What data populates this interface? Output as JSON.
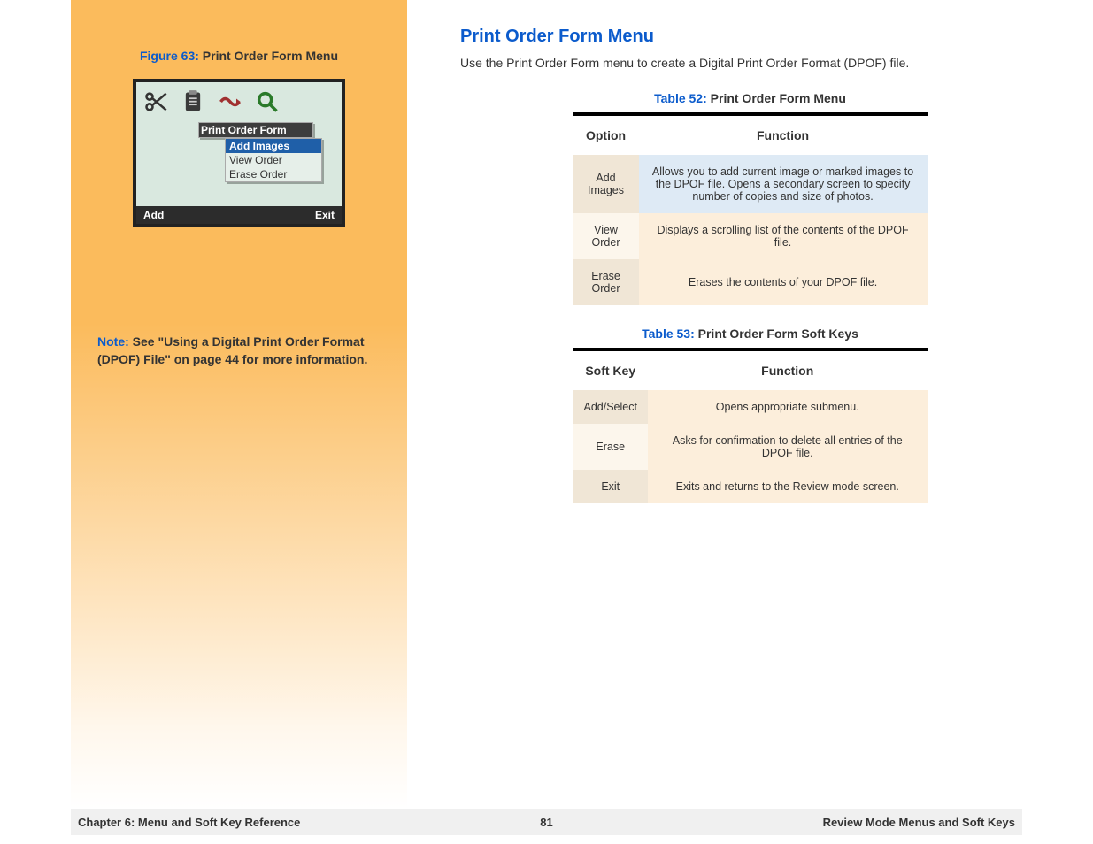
{
  "sidebar": {
    "figure_label": "Figure 63:",
    "figure_title": "Print Order Form Menu",
    "lcd": {
      "menu_title": "Print Order Form",
      "items": [
        "Add Images",
        "View Order",
        "Erase Order"
      ],
      "soft_left": "Add",
      "soft_right": "Exit"
    },
    "note_label": "Note:",
    "note_text_1": "See \"Using a Digital Print Order Format (DPOF) File\" on page 44 for more information."
  },
  "main": {
    "heading": "Print Order Form Menu",
    "intro": "Use the Print Order Form menu to create a Digital Print Order Format (DPOF) file.",
    "table52": {
      "label": "Table 52:",
      "title": "Print Order Form Menu",
      "headers": [
        "Option",
        "Function"
      ],
      "rows": [
        {
          "option": "Add Images",
          "function": "Allows you to add current image or marked images to the DPOF file. Opens a secondary screen to specify number of copies and size of photos."
        },
        {
          "option": "View Order",
          "function": "Displays a scrolling list of the contents of the DPOF file."
        },
        {
          "option": "Erase Order",
          "function": "Erases the contents of your DPOF file."
        }
      ]
    },
    "table53": {
      "label": "Table 53:",
      "title": "Print Order Form Soft Keys",
      "headers": [
        "Soft Key",
        "Function"
      ],
      "rows": [
        {
          "option": "Add/Select",
          "function": "Opens appropriate submenu."
        },
        {
          "option": "Erase",
          "function": "Asks for confirmation to delete all entries of the DPOF file."
        },
        {
          "option": "Exit",
          "function": "Exits and returns to the Review mode screen."
        }
      ]
    }
  },
  "footer": {
    "left": "Chapter 6: Menu and Soft Key Reference",
    "center": "81",
    "right": "Review Mode Menus and Soft Keys"
  }
}
